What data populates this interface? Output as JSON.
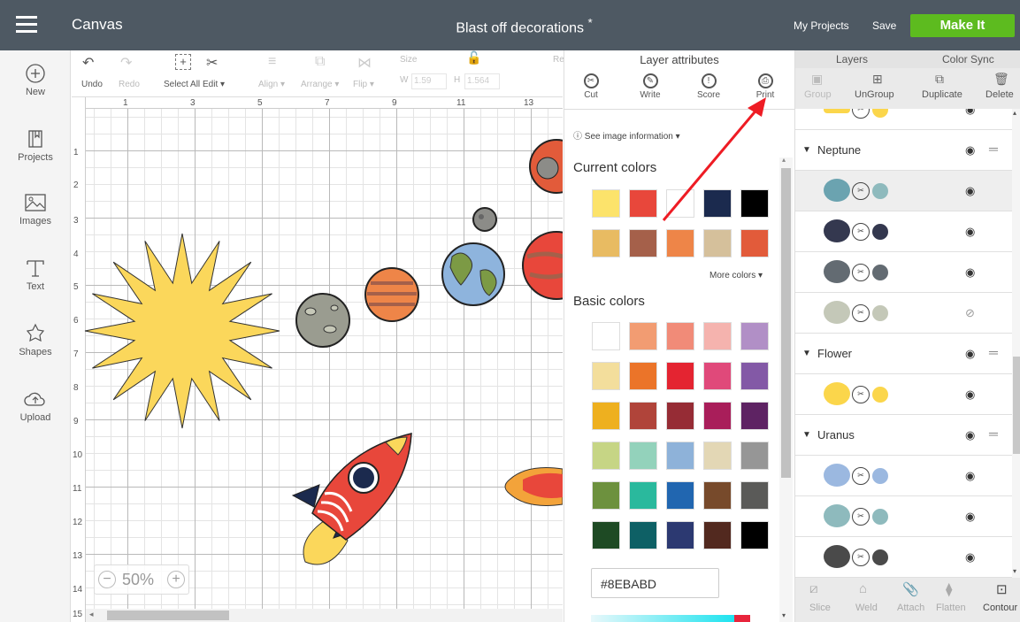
{
  "header": {
    "app": "Canvas",
    "doc_title": "Blast off decorations",
    "unsaved_marker": "*",
    "my_projects": "My Projects",
    "save": "Save",
    "make_it": "Make It"
  },
  "left_nav": [
    {
      "label": "New",
      "icon": "plus-circle-icon"
    },
    {
      "label": "Projects",
      "icon": "book-icon"
    },
    {
      "label": "Images",
      "icon": "image-icon"
    },
    {
      "label": "Text",
      "icon": "text-icon"
    },
    {
      "label": "Shapes",
      "icon": "shapes-icon"
    },
    {
      "label": "Upload",
      "icon": "upload-cloud-icon"
    }
  ],
  "toolbar": {
    "undo": "Undo",
    "redo": "Redo",
    "select_all": "Select All",
    "edit": "Edit",
    "align": "Align",
    "arrange": "Arrange",
    "flip": "Flip",
    "size": "Size",
    "w_label": "W",
    "w_value": "1.59",
    "h_label": "H",
    "h_value": "1.564",
    "rotate_label": "Re"
  },
  "ruler": {
    "top": [
      "1",
      "3",
      "5",
      "7",
      "9",
      "11",
      "13"
    ],
    "left": [
      "1",
      "2",
      "3",
      "4",
      "5",
      "6",
      "7",
      "8",
      "9",
      "10",
      "11",
      "12",
      "13",
      "14",
      "15"
    ]
  },
  "zoom": "50%",
  "panel": {
    "title": "Layer attributes",
    "actions": [
      {
        "label": "Cut",
        "glyph": "✂"
      },
      {
        "label": "Write",
        "glyph": "✎"
      },
      {
        "label": "Score",
        "glyph": "!"
      },
      {
        "label": "Print",
        "glyph": "⎙"
      }
    ],
    "see_image_info": "See image information",
    "current_colors_title": "Current colors",
    "current_colors": [
      "#FCE36B",
      "#E8473B",
      "#FFFFFF",
      "#1B2A4E",
      "#000000",
      "#E8BB62",
      "#A5604A",
      "#EE8548",
      "#D5C09B",
      "#E25B3A"
    ],
    "more_colors": "More colors",
    "basic_colors_title": "Basic colors",
    "basic_colors": [
      "#FFFFFF",
      "#F29C72",
      "#F18B78",
      "#F5B3AE",
      "#B18FC6",
      "#F3DE9C",
      "#EB7429",
      "#E42431",
      "#E0497A",
      "#8359A6",
      "#EEB01F",
      "#B0443A",
      "#962C35",
      "#A91E5A",
      "#5E2363",
      "#C6D585",
      "#93D2BB",
      "#8EB2D9",
      "#E3D7B5",
      "#969696",
      "#6D913E",
      "#2AB99D",
      "#2166B0",
      "#774A2B",
      "#5A5A58",
      "#1E4A24",
      "#0E6065",
      "#2C3971",
      "#52291F",
      "#000000"
    ],
    "hex_value": "#8EBABD"
  },
  "layers_panel": {
    "tabs": [
      "Layers",
      "Color Sync"
    ],
    "tools": [
      {
        "label": "Group",
        "enabled": false
      },
      {
        "label": "UnGroup",
        "enabled": true
      },
      {
        "label": "Duplicate",
        "enabled": true
      },
      {
        "label": "Delete",
        "enabled": true
      }
    ],
    "rows": [
      {
        "type": "layer",
        "thumb": "#FBD64B",
        "dot": "#FBD64B",
        "visible": true
      },
      {
        "type": "group",
        "name": "Neptune",
        "visible": true
      },
      {
        "type": "layer",
        "thumb": "#6BA3B0",
        "dot": "#8EBABD",
        "visible": true,
        "selected": true
      },
      {
        "type": "layer",
        "thumb": "#34384F",
        "dot": "#34384F",
        "visible": true
      },
      {
        "type": "layer",
        "thumb": "#636B72",
        "dot": "#636B72",
        "visible": true
      },
      {
        "type": "layer",
        "thumb": "#C4C8B8",
        "dot": "#C4C8B8",
        "visible": false
      },
      {
        "type": "group",
        "name": "Flower",
        "visible": true
      },
      {
        "type": "layer",
        "thumb": "#FBD64B",
        "dot": "#FBD64B",
        "visible": true
      },
      {
        "type": "group",
        "name": "Uranus",
        "visible": true
      },
      {
        "type": "layer",
        "thumb": "#9BB8E0",
        "dot": "#9BB8E0",
        "visible": true
      },
      {
        "type": "layer",
        "thumb": "#8EBABD",
        "dot": "#8EBABD",
        "visible": true
      },
      {
        "type": "layer",
        "thumb": "#4A4A4A",
        "dot": "#4A4A4A",
        "visible": true
      }
    ],
    "bottom_tools": [
      "Slice",
      "Weld",
      "Attach",
      "Flatten",
      "Contour"
    ]
  }
}
